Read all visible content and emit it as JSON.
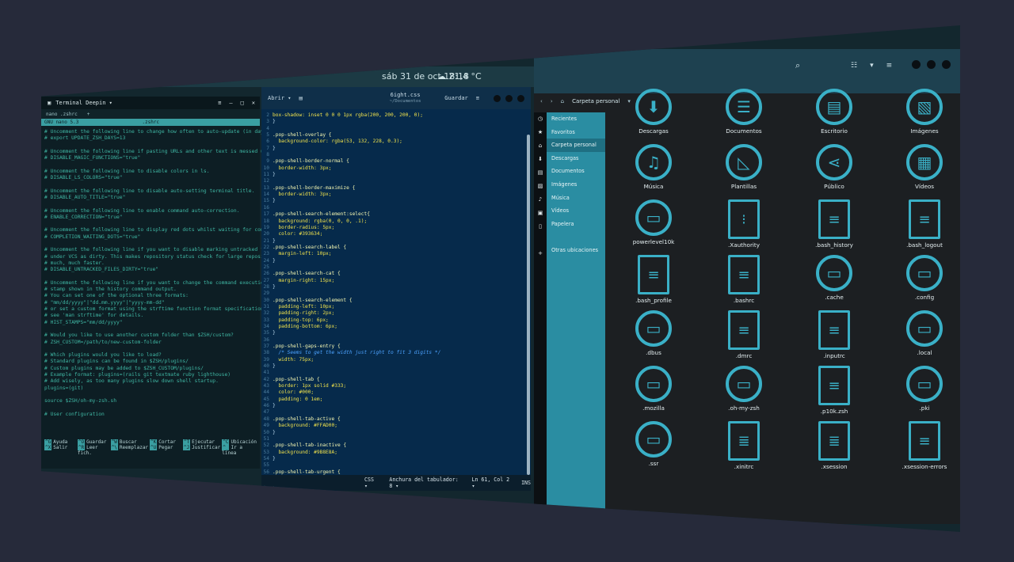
{
  "topbar": {
    "clock": "sáb 31 de oct  18:18",
    "weather": "☁ 21,4 °C"
  },
  "tray": {
    "icons": [
      "network-icon",
      "mute-icon",
      "power-icon"
    ]
  },
  "terminal": {
    "title": "Terminal Deepin ▾",
    "tab_label": "nano .zshrc",
    "nano_title": "GNU nano 5.3",
    "nano_file": ".zshrc",
    "lines": [
      "# Uncomment the following line to change how often to auto-update (in days).",
      "# export UPDATE_ZSH_DAYS=13",
      "",
      "# Uncomment the following line if pasting URLs and other text is messed up.",
      "# DISABLE_MAGIC_FUNCTIONS=\"true\"",
      "",
      "# Uncomment the following line to disable colors in ls.",
      "# DISABLE_LS_COLORS=\"true\"",
      "",
      "# Uncomment the following line to disable auto-setting terminal title.",
      "# DISABLE_AUTO_TITLE=\"true\"",
      "",
      "# Uncomment the following line to enable command auto-correction.",
      "# ENABLE_CORRECTION=\"true\"",
      "",
      "# Uncomment the following line to display red dots whilst waiting for completion.",
      "# COMPLETION_WAITING_DOTS=\"true\"",
      "",
      "# Uncomment the following line if you want to disable marking untracked files",
      "# under VCS as dirty. This makes repository status check for large repositories",
      "# much, much faster.",
      "# DISABLE_UNTRACKED_FILES_DIRTY=\"true\"",
      "",
      "# Uncomment the following line if you want to change the command execution time",
      "# stamp shown in the history command output.",
      "# You can set one of the optional three formats:",
      "# \"mm/dd/yyyy\"|\"dd.mm.yyyy\"|\"yyyy-mm-dd\"",
      "# or set a custom format using the strftime function format specifications,",
      "# see 'man strftime' for details.",
      "# HIST_STAMPS=\"mm/dd/yyyy\"",
      "",
      "# Would you like to use another custom folder than $ZSH/custom?",
      "# ZSH_CUSTOM=/path/to/new-custom-folder",
      "",
      "# Which plugins would you like to load?",
      "# Standard plugins can be found in $ZSH/plugins/",
      "# Custom plugins may be added to $ZSH_CUSTOM/plugins/",
      "# Example format: plugins=(rails git textmate ruby lighthouse)",
      "# Add wisely, as too many plugins slow down shell startup.",
      "plugins=(git)",
      "",
      "source $ZSH/oh-my-zsh.sh",
      "",
      "# User configuration"
    ],
    "keys": [
      {
        "k": "^G",
        "a": "Ayuda",
        "k2": "^X",
        "b": "Salir"
      },
      {
        "k": "^O",
        "a": "Guardar",
        "k2": "^R",
        "b": "Leer fich."
      },
      {
        "k": "^W",
        "a": "Buscar",
        "k2": "^\\",
        "b": "Reemplazar"
      },
      {
        "k": "^K",
        "a": "Cortar",
        "k2": "^U",
        "b": "Pegar"
      },
      {
        "k": "^T",
        "a": "Ejecutar",
        "k2": "^J",
        "b": "Justificar"
      },
      {
        "k": "^C",
        "a": "Ubicación",
        "k2": "^_",
        "b": "Ir a línea"
      }
    ]
  },
  "editor": {
    "open_label": "Abrir ▾",
    "filename": "6ight.css",
    "path": "~/Documentos",
    "save_label": "Guardar",
    "code": [
      "box-shadow: inset 0 0 0 1px rgba(200, 200, 200, 0);",
      "}",
      "",
      ".pop-shell-overlay {",
      "  background-color: rgba(53, 132, 228, 0.3);",
      "}",
      "",
      ".pop-shell-border-normal {",
      "  border-width: 3px;",
      "}",
      "",
      ".pop-shell-border-maximize {",
      "  border-width: 3px;",
      "}",
      "",
      ".pop-shell-search-element:select{",
      "  background: rgba(0, 0, 0, .1);",
      "  border-radius: 5px;",
      "  color: #393634;",
      "}",
      ".pop-shell-search-label {",
      "  margin-left: 10px;",
      "}",
      "",
      ".pop-shell-search-cat {",
      "  margin-right: 15px;",
      "}",
      "",
      ".pop-shell-search-element {",
      "  padding-left: 10px;",
      "  padding-right: 2px;",
      "  padding-top: 6px;",
      "  padding-bottom: 6px;",
      "}",
      "",
      ".pop-shell-gaps-entry {",
      "  /* Seems to get the width just right to fit 3 digits */",
      "  width: 75px;",
      "}",
      "",
      ".pop-shell-tab {",
      "  border: 1px solid #333;",
      "  color: #000;",
      "  padding: 0 1em;",
      "}",
      "",
      ".pop-shell-tab-active {",
      "  background: #FFAD00;",
      "}",
      "",
      ".pop-shell-tab-inactive {",
      "  background: #9B8E8A;",
      "}",
      "",
      ".pop-shell-tab-urgent {",
      "  background: #D00;",
      "}"
    ],
    "status": {
      "lang": "CSS ▾",
      "tab": "Anchura del tabulador: 8 ▾",
      "pos": "Ln 61, Col 2 ▾",
      "mode": "INS"
    }
  },
  "files": {
    "crumb": "Carpeta personal",
    "sidebar": [
      "Recientes",
      "Favoritos",
      "Carpeta personal",
      "Descargas",
      "Documentos",
      "Imágenes",
      "Música",
      "Vídeos",
      "Papelera",
      "",
      "Otras ubicaciones"
    ],
    "items": [
      {
        "name": "Descargas",
        "glyph": "⬇",
        "kind": "circle"
      },
      {
        "name": "Documentos",
        "glyph": "☰",
        "kind": "circle"
      },
      {
        "name": "Escritorio",
        "glyph": "▤",
        "kind": "circle"
      },
      {
        "name": "Imágenes",
        "glyph": "▧",
        "kind": "circle"
      },
      {
        "name": "Música",
        "glyph": "♫",
        "kind": "circle"
      },
      {
        "name": "Plantillas",
        "glyph": "◺",
        "kind": "circle"
      },
      {
        "name": "Público",
        "glyph": "⋖",
        "kind": "circle"
      },
      {
        "name": "Vídeos",
        "glyph": "▦",
        "kind": "circle"
      },
      {
        "name": "powerlevel10k",
        "glyph": "▭",
        "kind": "circle"
      },
      {
        "name": ".Xauthority",
        "glyph": "⁝",
        "kind": "doc"
      },
      {
        "name": ".bash_history",
        "glyph": "≡",
        "kind": "doc"
      },
      {
        "name": ".bash_logout",
        "glyph": "≡",
        "kind": "doc"
      },
      {
        "name": ".bash_profile",
        "glyph": "≡",
        "kind": "doc"
      },
      {
        "name": ".bashrc",
        "glyph": "≡",
        "kind": "doc"
      },
      {
        "name": ".cache",
        "glyph": "▭",
        "kind": "circle"
      },
      {
        "name": ".config",
        "glyph": "▭",
        "kind": "circle"
      },
      {
        "name": ".dbus",
        "glyph": "▭",
        "kind": "circle"
      },
      {
        "name": ".dmrc",
        "glyph": "≡",
        "kind": "doc"
      },
      {
        "name": ".inputrc",
        "glyph": "≡",
        "kind": "doc"
      },
      {
        "name": ".local",
        "glyph": "▭",
        "kind": "circle"
      },
      {
        "name": ".mozilla",
        "glyph": "▭",
        "kind": "circle"
      },
      {
        "name": ".oh-my-zsh",
        "glyph": "▭",
        "kind": "circle"
      },
      {
        "name": ".p10k.zsh",
        "glyph": "≡",
        "kind": "doc"
      },
      {
        "name": ".pki",
        "glyph": "▭",
        "kind": "circle"
      },
      {
        "name": ".ssr",
        "glyph": "▭",
        "kind": "circle"
      },
      {
        "name": ".xinitrc",
        "glyph": "≣",
        "kind": "doc"
      },
      {
        "name": ".xsession",
        "glyph": "≣",
        "kind": "doc"
      },
      {
        "name": ".xsession-errors",
        "glyph": "≡",
        "kind": "doc"
      }
    ]
  }
}
